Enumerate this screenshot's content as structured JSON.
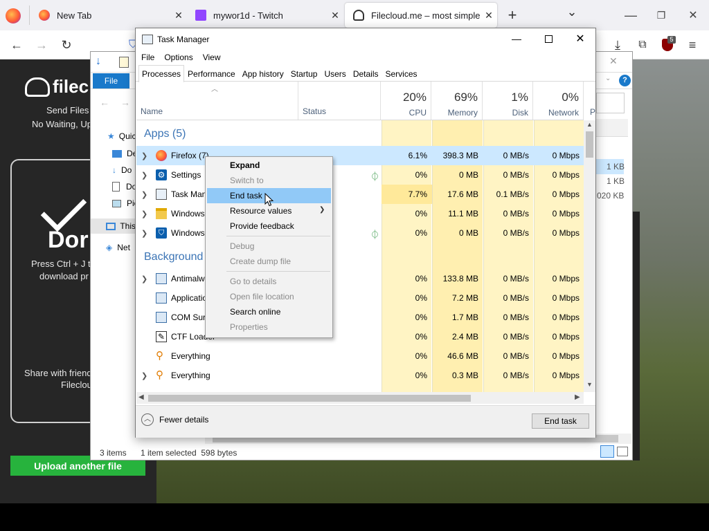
{
  "browser": {
    "tabs": [
      {
        "label": "New Tab"
      },
      {
        "label": "mywor1d - Twitch"
      },
      {
        "label": "Filecloud.me – most simple file"
      }
    ],
    "new_tab": "+",
    "tab_list": "⌄",
    "extension_badge": "5"
  },
  "filecloud": {
    "logo": "filec",
    "tagline1": "Send Files",
    "tagline2": "No Waiting, Up",
    "done_heading": "Dor",
    "done_hint1": "Press Ctrl + J to",
    "done_hint2": "download pr",
    "share1": "Share with friend",
    "share2": "Filecloud",
    "upload_button": "Upload another file"
  },
  "explorer": {
    "ribbon_file": "File",
    "nav_items": [
      "Quic",
      "De",
      "Do",
      "Do",
      "Pic",
      "This",
      "Net"
    ],
    "sizes": [
      "1 KB",
      "1 KB",
      "020 KB"
    ],
    "status_items": "3 items",
    "status_selected": "1 item selected  598 bytes"
  },
  "taskmanager": {
    "title": "Task Manager",
    "menu": [
      "File",
      "Options",
      "View"
    ],
    "tabs": [
      "Processes",
      "Performance",
      "App history",
      "Startup",
      "Users",
      "Details",
      "Services"
    ],
    "columns": {
      "name": "Name",
      "status": "Status",
      "cpu": {
        "pct": "20%",
        "label": "CPU"
      },
      "memory": {
        "pct": "69%",
        "label": "Memory"
      },
      "disk": {
        "pct": "1%",
        "label": "Disk"
      },
      "network": {
        "pct": "0%",
        "label": "Network"
      },
      "power": "P"
    },
    "groups": {
      "apps": "Apps (5)",
      "background": "Background p"
    },
    "rows": [
      {
        "name": "Firefox (7)",
        "cpu": "6.1%",
        "mem": "398.3 MB",
        "disk": "0 MB/s",
        "net": "0 Mbps"
      },
      {
        "name": "Settings",
        "cpu": "0%",
        "mem": "0 MB",
        "disk": "0 MB/s",
        "net": "0 Mbps"
      },
      {
        "name": "Task Man",
        "cpu": "7.7%",
        "mem": "17.6 MB",
        "disk": "0.1 MB/s",
        "net": "0 Mbps"
      },
      {
        "name": "Windows",
        "cpu": "0%",
        "mem": "11.1 MB",
        "disk": "0 MB/s",
        "net": "0 Mbps"
      },
      {
        "name": "Windows",
        "cpu": "0%",
        "mem": "0 MB",
        "disk": "0 MB/s",
        "net": "0 Mbps"
      },
      {
        "name": "Antimalw",
        "cpu": "0%",
        "mem": "133.8 MB",
        "disk": "0 MB/s",
        "net": "0 Mbps"
      },
      {
        "name": "Applicatio",
        "cpu": "0%",
        "mem": "7.2 MB",
        "disk": "0 MB/s",
        "net": "0 Mbps"
      },
      {
        "name": "COM Sur",
        "cpu": "0%",
        "mem": "1.7 MB",
        "disk": "0 MB/s",
        "net": "0 Mbps"
      },
      {
        "name": "CTF Loader",
        "cpu": "0%",
        "mem": "2.4 MB",
        "disk": "0 MB/s",
        "net": "0 Mbps"
      },
      {
        "name": "Everything",
        "cpu": "0%",
        "mem": "46.6 MB",
        "disk": "0 MB/s",
        "net": "0 Mbps"
      },
      {
        "name": "Everything",
        "cpu": "0%",
        "mem": "0.3 MB",
        "disk": "0 MB/s",
        "net": "0 Mbps"
      }
    ],
    "fewer_details": "Fewer details",
    "end_task": "End task"
  },
  "context_menu": {
    "items": [
      "Expand",
      "Switch to",
      "End task",
      "Resource values",
      "Provide feedback",
      "Debug",
      "Create dump file",
      "Go to details",
      "Open file location",
      "Search online",
      "Properties"
    ]
  },
  "colors": {
    "highlight": "#91c9f7",
    "cpu_heat": "#fff4c4",
    "upload_green": "#27b33d",
    "group_blue": "#3b74b5"
  }
}
